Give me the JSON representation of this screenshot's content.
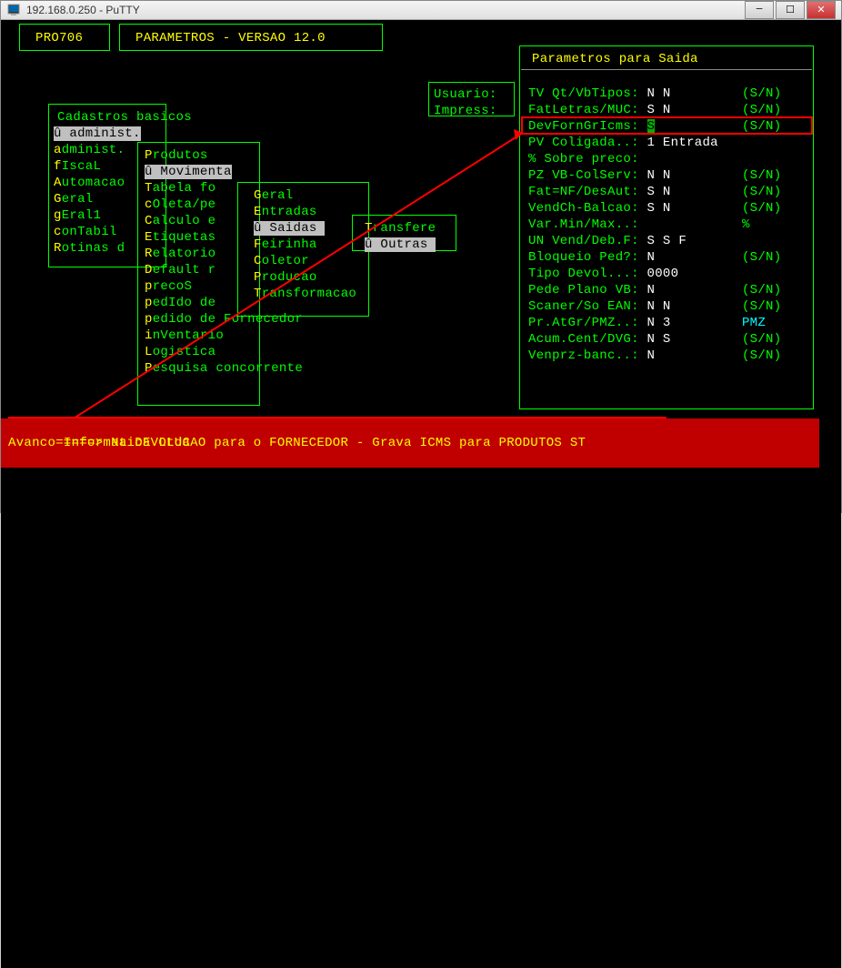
{
  "window": {
    "title": "192.168.0.250 - PuTTY"
  },
  "header": {
    "code": "PRO706",
    "title": "PARAMETROS - VERSAO 12.0"
  },
  "labels": {
    "usuario": "Usuario:",
    "impress": "Impress:"
  },
  "menu1": {
    "title": "Cadastros basicos",
    "items": [
      {
        "text": "û administ.",
        "sel": true
      },
      {
        "text": "administ."
      },
      {
        "text": "fIscaL"
      },
      {
        "text": "Automacao"
      },
      {
        "text": "Geral"
      },
      {
        "text": "gEral1"
      },
      {
        "text": "conTabil"
      },
      {
        "text": "Rotinas d"
      }
    ]
  },
  "menu2": {
    "items": [
      {
        "text": "Produtos"
      },
      {
        "text": "û Movimenta",
        "sel": true
      },
      {
        "text": "Tabela fo"
      },
      {
        "text": "cOleta/pe"
      },
      {
        "text": "Calculo e"
      },
      {
        "text": "Etiquetas"
      },
      {
        "text": "Relatorio"
      },
      {
        "text": "Default r"
      },
      {
        "text": "precoS"
      },
      {
        "text": "pedIdo de"
      },
      {
        "text": "pedido de Fornecedor"
      },
      {
        "text": "inVentario"
      },
      {
        "text": "Logistica"
      },
      {
        "text": "Pesquisa concorrente"
      }
    ]
  },
  "menu3": {
    "items": [
      {
        "text": "Geral"
      },
      {
        "text": "Entradas"
      },
      {
        "text": "û Saidas",
        "sel": true
      },
      {
        "text": "Feirinha"
      },
      {
        "text": "Coletor"
      },
      {
        "text": "Producao"
      },
      {
        "text": "Transformacao"
      }
    ]
  },
  "menu4": {
    "items": [
      {
        "text": "Transfere"
      },
      {
        "text": "û Outras",
        "sel": true
      }
    ]
  },
  "panel": {
    "title": "Parametros para Saida",
    "rows": [
      {
        "label": "TV Qt/VbTipos:",
        "val": "N N",
        "suf": "(S/N)"
      },
      {
        "label": "FatLetras/MUC:",
        "val": "S N",
        "suf": "(S/N)"
      },
      {
        "label": "DevFornGrIcms:",
        "val": "S",
        "suf": "(S/N)",
        "hl": true
      },
      {
        "label": "PV Coligada..:",
        "val": "1 Entrada",
        "suf": ""
      },
      {
        "label": "% Sobre preco:",
        "val": "",
        "suf": ""
      },
      {
        "label": "PZ VB-ColServ:",
        "val": "N N",
        "suf": "(S/N)"
      },
      {
        "label": "Fat=NF/DesAut:",
        "val": "S N",
        "suf": "(S/N)"
      },
      {
        "label": "VendCh-Balcao:",
        "val": "S N",
        "suf": "(S/N)"
      },
      {
        "label": "Var.Min/Max..:",
        "val": "",
        "suf": "%"
      },
      {
        "label": "UN Vend/Deb.F:",
        "val": "S S F",
        "suf": ""
      },
      {
        "label": "Bloqueio Ped?:",
        "val": "N",
        "suf": "(S/N)"
      },
      {
        "label": "Tipo Devol...:",
        "val": "0000",
        "suf": ""
      },
      {
        "label": "Pede Plano VB:",
        "val": "N",
        "suf": "(S/N)"
      },
      {
        "label": "Scaner/So EAN:",
        "val": "N N",
        "suf": "(S/N)"
      },
      {
        "label": "Pr.AtGr/PMZ..:",
        "val": "N 3",
        "suf": "PMZ",
        "cyanSuf": true
      },
      {
        "label": "Acum.Cent/DVG:",
        "val": "N S",
        "suf": "(S/N)"
      },
      {
        "label": "Venprz-banc..:",
        "val": "N",
        "suf": "(S/N)"
      }
    ]
  },
  "status": {
    "prefix": "=====>",
    "text": "Na DEVOLUCAO para o FORNECEDOR - Grava ICMS para PRODUTOS ST"
  },
  "footer": "Avanco Informatica Ltda"
}
